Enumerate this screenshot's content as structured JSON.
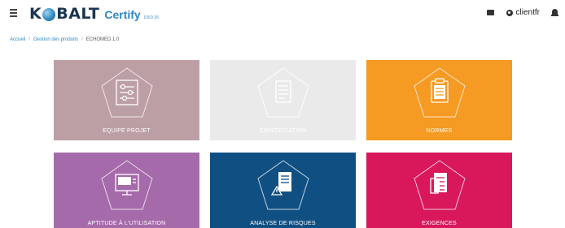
{
  "header": {
    "brand": {
      "prefix": "K",
      "suffix": "BALT"
    },
    "product": "Certify",
    "version": "0.8.0.16",
    "user": "clientfr",
    "icons": [
      "menu-icon",
      "mail-icon",
      "gear-icon",
      "bell-icon"
    ]
  },
  "breadcrumb": {
    "items": [
      "Accueil",
      "Gestion des produits"
    ],
    "current": "ECHOMED 1.0"
  },
  "tiles": [
    {
      "label": "EQUIPE PROJET",
      "color": "#bc9fa5",
      "icon": "sliders-icon",
      "enabled": true
    },
    {
      "label": "IDENTIFICATION",
      "color": "#eaeaea",
      "icon": "document-icon",
      "enabled": false
    },
    {
      "label": "NORMES",
      "color": "#f59a23",
      "icon": "clipboard-icon",
      "enabled": true
    },
    {
      "label": "APTITUDE À L'UTILISATION",
      "color": "#a56aaa",
      "icon": "monitor-icon",
      "enabled": true
    },
    {
      "label": "ANALYSE DE RISQUES",
      "color": "#104f82",
      "icon": "risk-document-icon",
      "enabled": true
    },
    {
      "label": "EXIGENCES",
      "color": "#d8185a",
      "icon": "requirements-icon",
      "enabled": true
    }
  ]
}
